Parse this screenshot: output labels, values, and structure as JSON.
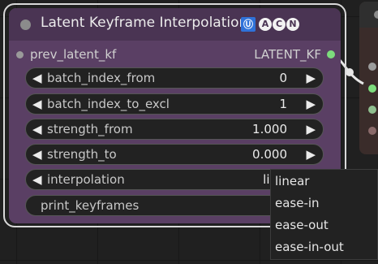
{
  "node": {
    "title": "Latent Keyframe Interpolation",
    "badges": {
      "box": "Ⓤ",
      "a": "A",
      "c": "C",
      "n": "N"
    },
    "input_label": "prev_latent_kf",
    "output_label": "LATENT_KF",
    "widgets": [
      {
        "label": "batch_index_from",
        "value": "0"
      },
      {
        "label": "batch_index_to_excl",
        "value": "1"
      },
      {
        "label": "strength_from",
        "value": "1.000"
      },
      {
        "label": "strength_to",
        "value": "0.000"
      },
      {
        "label": "interpolation",
        "value": "lin"
      }
    ],
    "button_label": "print_keyframes"
  },
  "dropdown": {
    "options": [
      "linear",
      "ease-in",
      "ease-out",
      "ease-in-out"
    ]
  },
  "colors": {
    "node_body": "#5a3f64",
    "node_title": "#4a3453",
    "output_slot": "#7ddc7d"
  }
}
